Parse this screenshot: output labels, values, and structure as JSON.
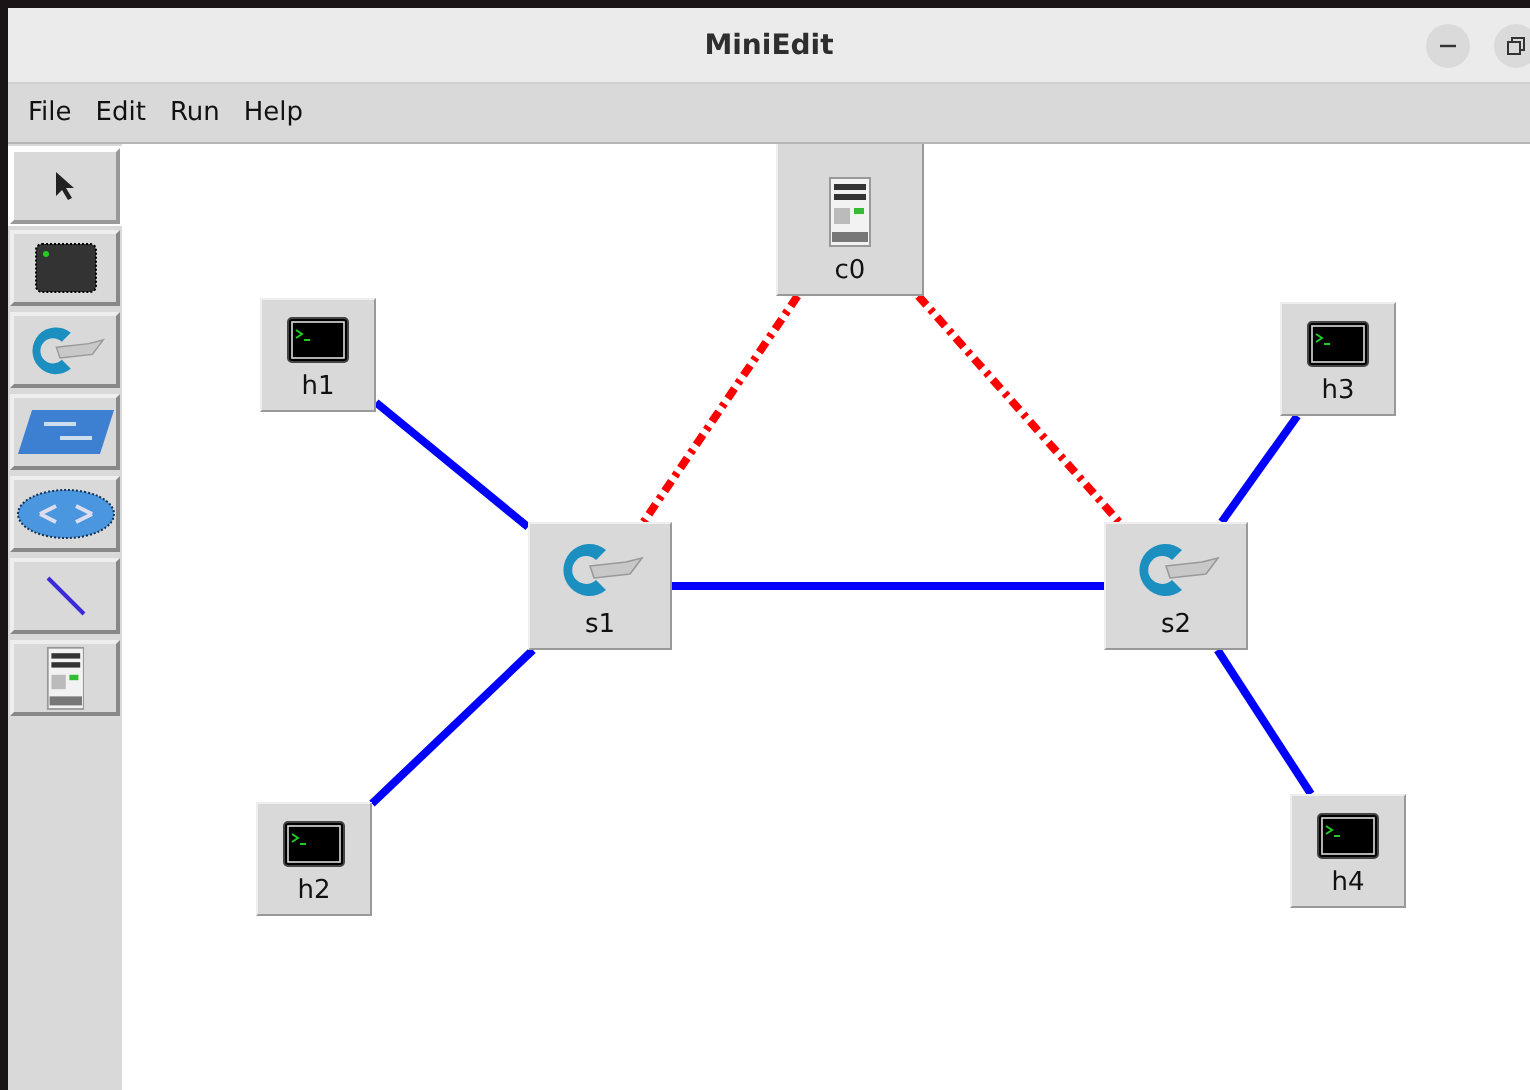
{
  "window": {
    "title": "MiniEdit"
  },
  "menu": [
    "File",
    "Edit",
    "Run",
    "Help"
  ],
  "tools": [
    {
      "kind": "select",
      "selected": true
    },
    {
      "kind": "host",
      "selected": false
    },
    {
      "kind": "switch",
      "selected": false
    },
    {
      "kind": "legacy-switch",
      "selected": false
    },
    {
      "kind": "legacy-router",
      "selected": false
    },
    {
      "kind": "link",
      "selected": false
    },
    {
      "kind": "controller",
      "selected": false
    }
  ],
  "nodes": [
    {
      "kind": "controller",
      "label": "c0"
    },
    {
      "kind": "host",
      "label": "h1"
    },
    {
      "kind": "host",
      "label": "h3"
    },
    {
      "kind": "switch",
      "label": "s1"
    },
    {
      "kind": "switch",
      "label": "s2"
    },
    {
      "kind": "host",
      "label": "h2"
    },
    {
      "kind": "host",
      "label": "h4"
    }
  ],
  "links": [
    {
      "kind": "data"
    },
    {
      "kind": "data"
    },
    {
      "kind": "data"
    },
    {
      "kind": "data"
    },
    {
      "kind": "data"
    },
    {
      "kind": "control"
    },
    {
      "kind": "control"
    }
  ]
}
